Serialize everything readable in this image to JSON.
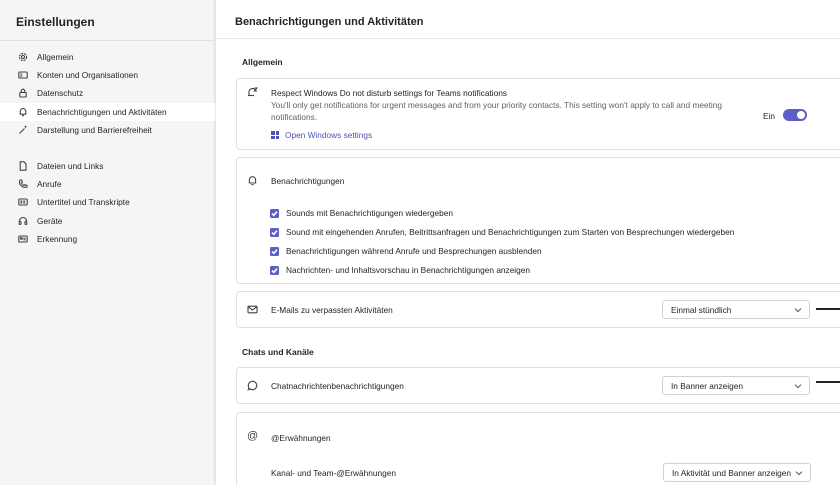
{
  "sidebar": {
    "title": "Einstellungen",
    "items": [
      {
        "label": "Allgemein",
        "icon": "gear-icon"
      },
      {
        "label": "Konten und Organisationen",
        "icon": "id-card-icon"
      },
      {
        "label": "Datenschutz",
        "icon": "lock-icon"
      },
      {
        "label": "Benachrichtigungen und Aktivitäten",
        "icon": "bell-icon"
      },
      {
        "label": "Darstellung und Barrierefreiheit",
        "icon": "magic-wand-icon"
      }
    ],
    "items2": [
      {
        "label": "Dateien und Links",
        "icon": "document-icon"
      },
      {
        "label": "Anrufe",
        "icon": "phone-icon"
      },
      {
        "label": "Untertitel und Transkripte",
        "icon": "closed-caption-icon"
      },
      {
        "label": "Geräte",
        "icon": "headset-icon"
      },
      {
        "label": "Erkennung",
        "icon": "person-id-icon"
      }
    ]
  },
  "main": {
    "title": "Benachrichtigungen und Aktivitäten",
    "section_general": "Allgemein",
    "dnd": {
      "title": "Respect Windows Do not disturb settings for Teams notifications",
      "description": "You'll only get notifications for urgent messages and from your priority contacts. This setting won't apply to call and meeting notifications.",
      "link": "Open Windows settings",
      "toggle_label": "Ein",
      "toggle_on": true
    },
    "notifications": {
      "title": "Benachrichtigungen",
      "checks": [
        "Sounds mit Benachrichtigungen wiedergeben",
        "Sound mit eingehenden Anrufen, Beitrittsanfragen und Benachrichtigungen zum Starten von Besprechungen wiedergeben",
        "Benachrichtigungen während Anrufe und Besprechungen ausblenden",
        "Nachrichten- und Inhaltsvorschau in Benachrichtigungen anzeigen"
      ]
    },
    "email": {
      "label": "E-Mails zu verpassten Aktivitäten",
      "value": "Einmal stündlich"
    },
    "section_chats": "Chats und Kanäle",
    "chat": {
      "label": "Chatnachrichtenbenachrichtigungen",
      "value": "In Banner anzeigen"
    },
    "mentions": {
      "title": "@Erwähnungen",
      "label": "Kanal- und Team-@Erwähnungen",
      "value": "In Aktivität und Banner anzeigen"
    }
  },
  "colors": {
    "accent": "#5b5fc7",
    "link": "#4f52b2",
    "sidebar_bg": "#f5f5f5"
  }
}
